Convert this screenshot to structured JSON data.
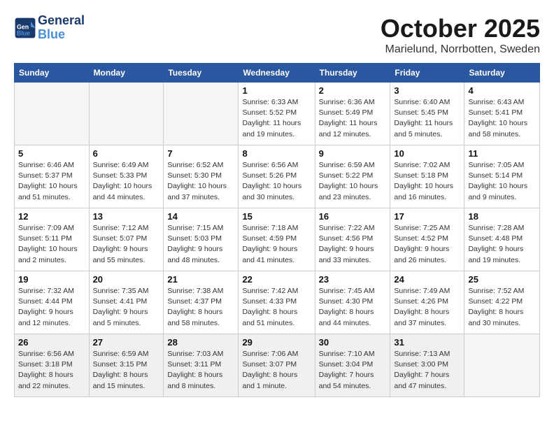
{
  "header": {
    "logo_line1": "General",
    "logo_line2": "Blue",
    "title": "October 2025",
    "subtitle": "Marielund, Norrbotten, Sweden"
  },
  "weekdays": [
    "Sunday",
    "Monday",
    "Tuesday",
    "Wednesday",
    "Thursday",
    "Friday",
    "Saturday"
  ],
  "weeks": [
    [
      {
        "day": "",
        "info": ""
      },
      {
        "day": "",
        "info": ""
      },
      {
        "day": "",
        "info": ""
      },
      {
        "day": "1",
        "info": "Sunrise: 6:33 AM\nSunset: 5:52 PM\nDaylight: 11 hours\nand 19 minutes."
      },
      {
        "day": "2",
        "info": "Sunrise: 6:36 AM\nSunset: 5:49 PM\nDaylight: 11 hours\nand 12 minutes."
      },
      {
        "day": "3",
        "info": "Sunrise: 6:40 AM\nSunset: 5:45 PM\nDaylight: 11 hours\nand 5 minutes."
      },
      {
        "day": "4",
        "info": "Sunrise: 6:43 AM\nSunset: 5:41 PM\nDaylight: 10 hours\nand 58 minutes."
      }
    ],
    [
      {
        "day": "5",
        "info": "Sunrise: 6:46 AM\nSunset: 5:37 PM\nDaylight: 10 hours\nand 51 minutes."
      },
      {
        "day": "6",
        "info": "Sunrise: 6:49 AM\nSunset: 5:33 PM\nDaylight: 10 hours\nand 44 minutes."
      },
      {
        "day": "7",
        "info": "Sunrise: 6:52 AM\nSunset: 5:30 PM\nDaylight: 10 hours\nand 37 minutes."
      },
      {
        "day": "8",
        "info": "Sunrise: 6:56 AM\nSunset: 5:26 PM\nDaylight: 10 hours\nand 30 minutes."
      },
      {
        "day": "9",
        "info": "Sunrise: 6:59 AM\nSunset: 5:22 PM\nDaylight: 10 hours\nand 23 minutes."
      },
      {
        "day": "10",
        "info": "Sunrise: 7:02 AM\nSunset: 5:18 PM\nDaylight: 10 hours\nand 16 minutes."
      },
      {
        "day": "11",
        "info": "Sunrise: 7:05 AM\nSunset: 5:14 PM\nDaylight: 10 hours\nand 9 minutes."
      }
    ],
    [
      {
        "day": "12",
        "info": "Sunrise: 7:09 AM\nSunset: 5:11 PM\nDaylight: 10 hours\nand 2 minutes."
      },
      {
        "day": "13",
        "info": "Sunrise: 7:12 AM\nSunset: 5:07 PM\nDaylight: 9 hours\nand 55 minutes."
      },
      {
        "day": "14",
        "info": "Sunrise: 7:15 AM\nSunset: 5:03 PM\nDaylight: 9 hours\nand 48 minutes."
      },
      {
        "day": "15",
        "info": "Sunrise: 7:18 AM\nSunset: 4:59 PM\nDaylight: 9 hours\nand 41 minutes."
      },
      {
        "day": "16",
        "info": "Sunrise: 7:22 AM\nSunset: 4:56 PM\nDaylight: 9 hours\nand 33 minutes."
      },
      {
        "day": "17",
        "info": "Sunrise: 7:25 AM\nSunset: 4:52 PM\nDaylight: 9 hours\nand 26 minutes."
      },
      {
        "day": "18",
        "info": "Sunrise: 7:28 AM\nSunset: 4:48 PM\nDaylight: 9 hours\nand 19 minutes."
      }
    ],
    [
      {
        "day": "19",
        "info": "Sunrise: 7:32 AM\nSunset: 4:44 PM\nDaylight: 9 hours\nand 12 minutes."
      },
      {
        "day": "20",
        "info": "Sunrise: 7:35 AM\nSunset: 4:41 PM\nDaylight: 9 hours\nand 5 minutes."
      },
      {
        "day": "21",
        "info": "Sunrise: 7:38 AM\nSunset: 4:37 PM\nDaylight: 8 hours\nand 58 minutes."
      },
      {
        "day": "22",
        "info": "Sunrise: 7:42 AM\nSunset: 4:33 PM\nDaylight: 8 hours\nand 51 minutes."
      },
      {
        "day": "23",
        "info": "Sunrise: 7:45 AM\nSunset: 4:30 PM\nDaylight: 8 hours\nand 44 minutes."
      },
      {
        "day": "24",
        "info": "Sunrise: 7:49 AM\nSunset: 4:26 PM\nDaylight: 8 hours\nand 37 minutes."
      },
      {
        "day": "25",
        "info": "Sunrise: 7:52 AM\nSunset: 4:22 PM\nDaylight: 8 hours\nand 30 minutes."
      }
    ],
    [
      {
        "day": "26",
        "info": "Sunrise: 6:56 AM\nSunset: 3:18 PM\nDaylight: 8 hours\nand 22 minutes."
      },
      {
        "day": "27",
        "info": "Sunrise: 6:59 AM\nSunset: 3:15 PM\nDaylight: 8 hours\nand 15 minutes."
      },
      {
        "day": "28",
        "info": "Sunrise: 7:03 AM\nSunset: 3:11 PM\nDaylight: 8 hours\nand 8 minutes."
      },
      {
        "day": "29",
        "info": "Sunrise: 7:06 AM\nSunset: 3:07 PM\nDaylight: 8 hours\nand 1 minute."
      },
      {
        "day": "30",
        "info": "Sunrise: 7:10 AM\nSunset: 3:04 PM\nDaylight: 7 hours\nand 54 minutes."
      },
      {
        "day": "31",
        "info": "Sunrise: 7:13 AM\nSunset: 3:00 PM\nDaylight: 7 hours\nand 47 minutes."
      },
      {
        "day": "",
        "info": ""
      }
    ]
  ]
}
